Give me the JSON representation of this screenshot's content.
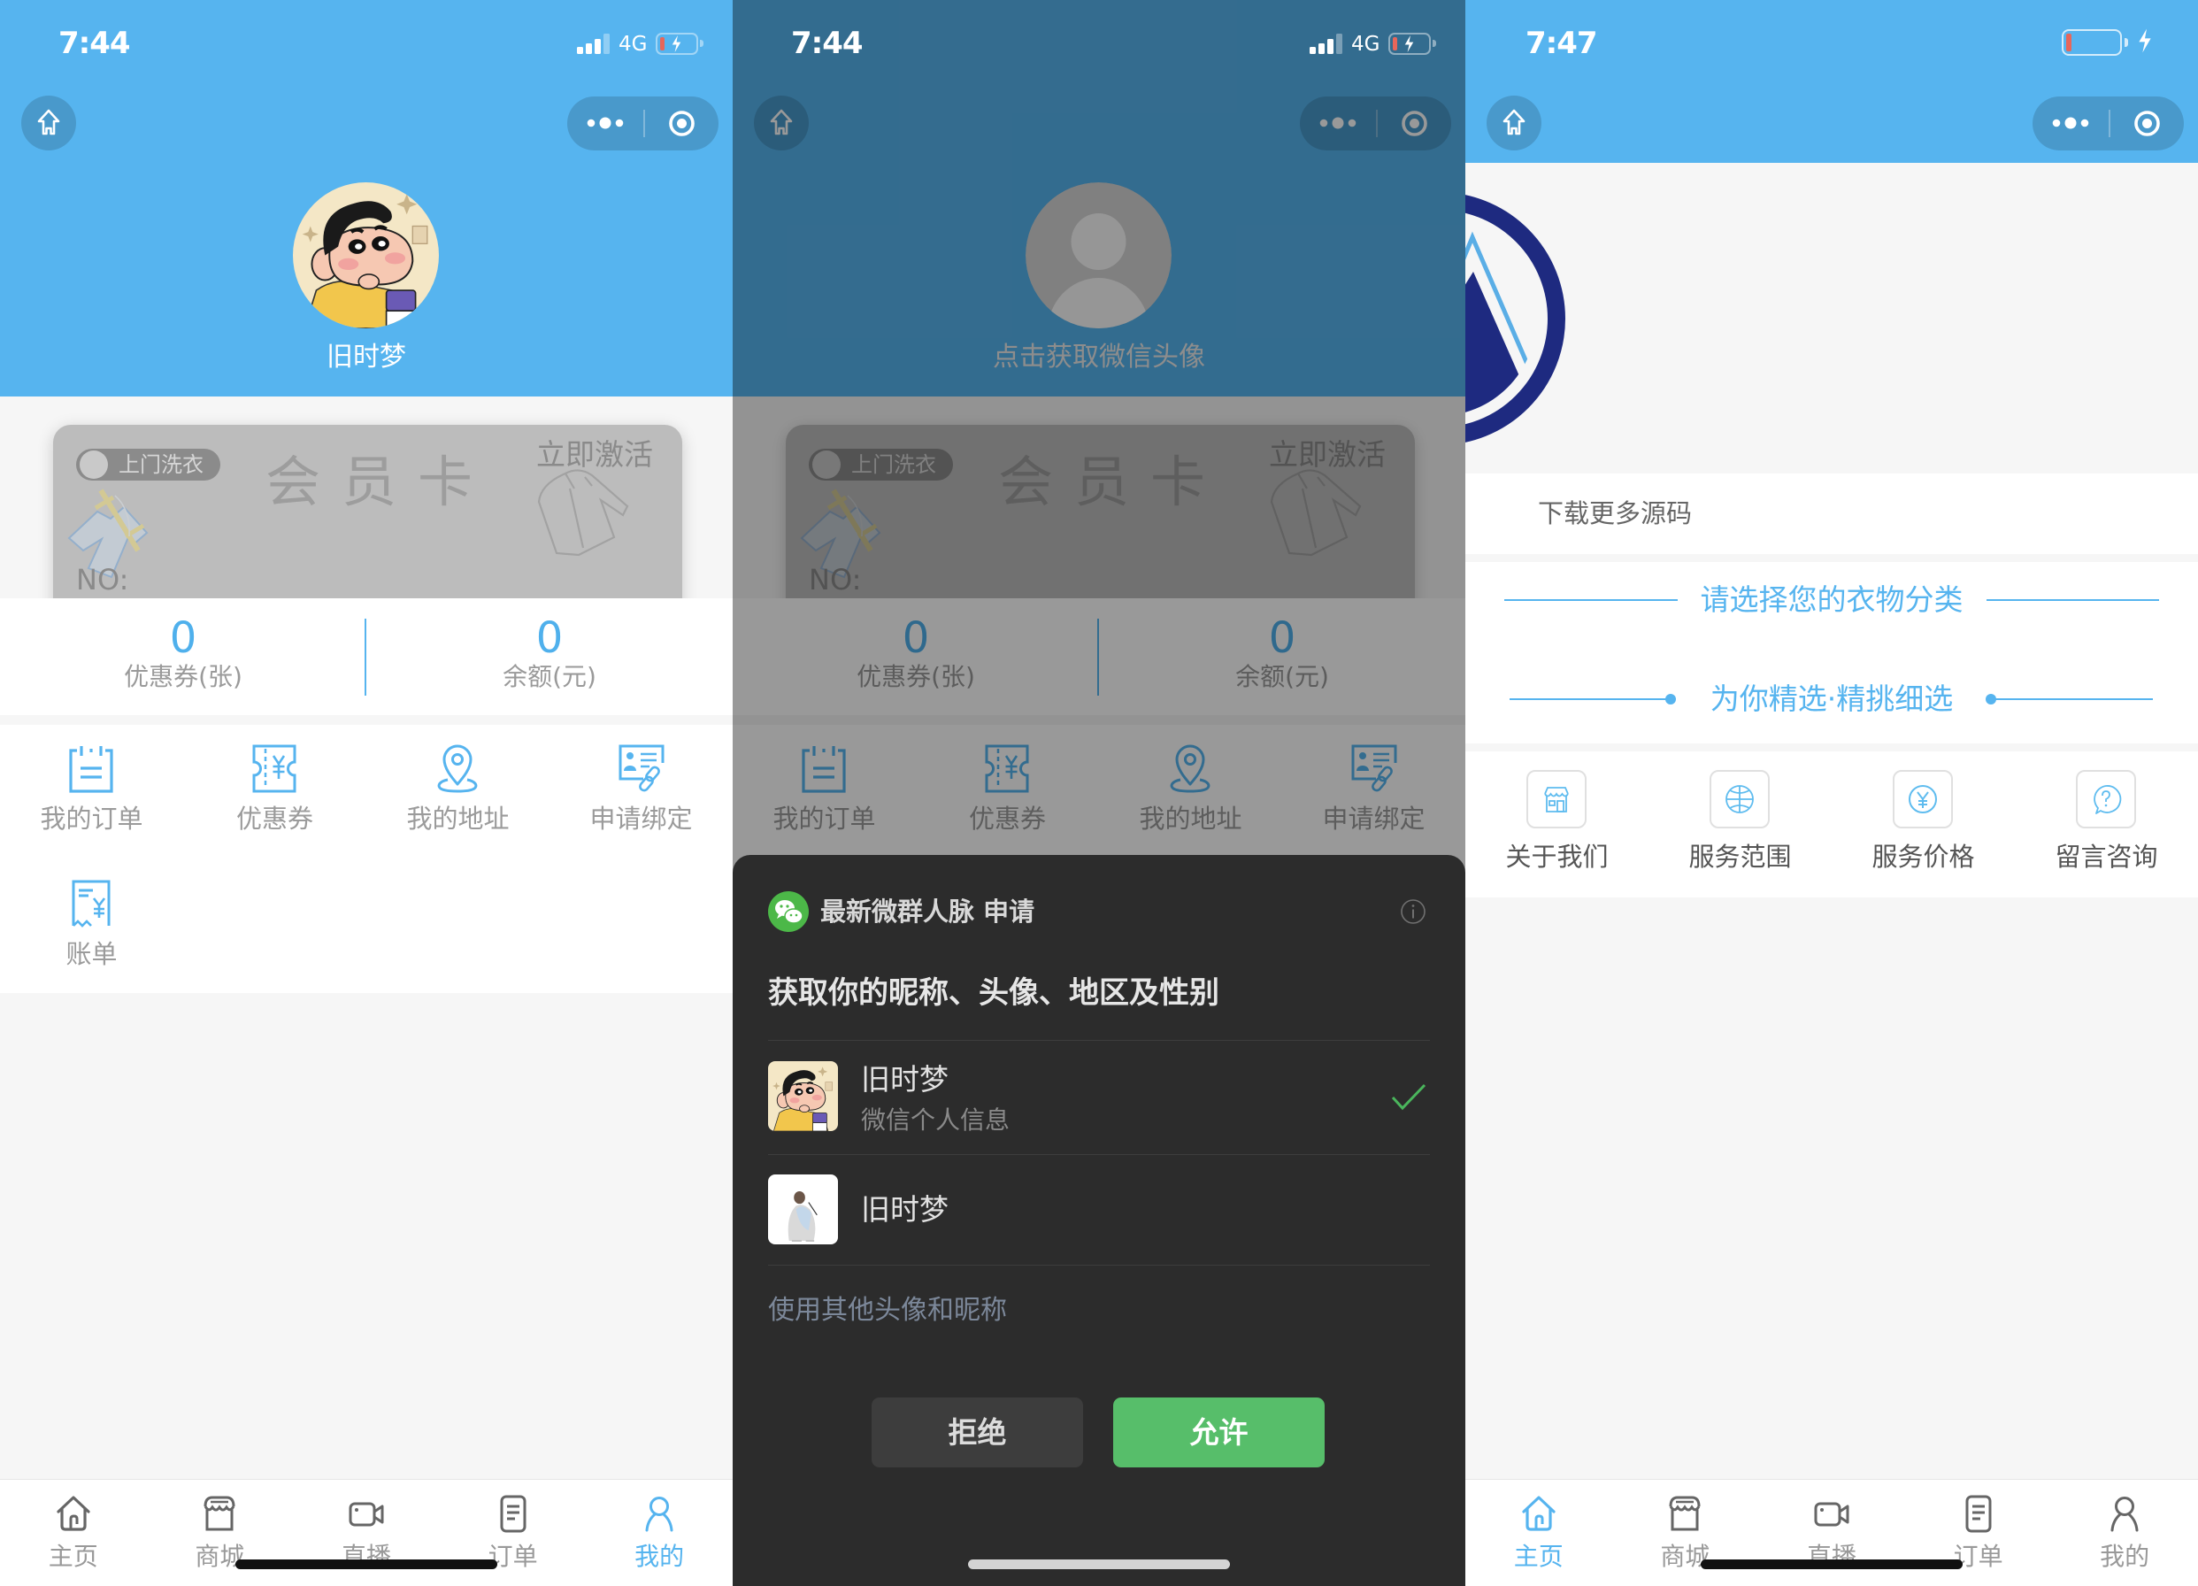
{
  "theme": {
    "accent": "#56b4ef",
    "allow_button": "#57be6a",
    "sheet_background": "#2c2c2c",
    "low_battery": "#e8665a"
  },
  "tabbar": [
    {
      "label": "主页",
      "icon": "home-icon"
    },
    {
      "label": "商城",
      "icon": "store-icon"
    },
    {
      "label": "直播",
      "icon": "video-camera-icon"
    },
    {
      "label": "订单",
      "icon": "document-icon"
    },
    {
      "label": "我的",
      "icon": "user-icon"
    }
  ],
  "screens": {
    "profile": {
      "status_bar": {
        "time": "7:44",
        "network": "4G",
        "battery_level": 0.12,
        "charging": true
      },
      "username": "旧时梦",
      "member_card": {
        "badge": "上门洗衣",
        "title": "会员卡",
        "activate": "立即激活",
        "number_label": "NO:"
      },
      "stats": [
        {
          "value": "0",
          "label": "优惠券(张)"
        },
        {
          "value": "0",
          "label": "余额(元)"
        }
      ],
      "menu": [
        {
          "label": "我的订单",
          "icon": "clipboard-icon"
        },
        {
          "label": "优惠券",
          "icon": "coupon-icon"
        },
        {
          "label": "我的地址",
          "icon": "location-pin-icon"
        },
        {
          "label": "申请绑定",
          "icon": "id-card-link-icon"
        },
        {
          "label": "账单",
          "icon": "receipt-icon"
        }
      ],
      "active_tab": "我的"
    },
    "auth": {
      "status_bar": {
        "time": "7:44",
        "network": "4G",
        "battery_level": 0.12,
        "charging": true
      },
      "avatar_prompt": "点击获取微信头像",
      "member_card": {
        "badge": "上门洗衣",
        "title": "会员卡",
        "activate": "立即激活",
        "number_label": "NO:"
      },
      "stats": [
        {
          "value": "0",
          "label": "优惠券(张)"
        },
        {
          "value": "0",
          "label": "余额(元)"
        }
      ],
      "menu": [
        {
          "label": "我的订单",
          "icon": "clipboard-icon"
        },
        {
          "label": "优惠券",
          "icon": "coupon-icon"
        },
        {
          "label": "我的地址",
          "icon": "location-pin-icon"
        },
        {
          "label": "申请绑定",
          "icon": "id-card-link-icon"
        }
      ],
      "auth_sheet": {
        "app_icon": "wechat-icon",
        "app_name": "最新微群人脉",
        "request_label": "申请",
        "heading": "获取你的昵称、头像、地区及性别",
        "profiles": [
          {
            "name": "旧时梦",
            "subtitle": "微信个人信息",
            "selected": true
          },
          {
            "name": "旧时梦",
            "selected": false
          }
        ],
        "other_option": "使用其他头像和昵称",
        "reject_label": "拒绝",
        "allow_label": "允许"
      }
    },
    "home": {
      "status_bar": {
        "time": "7:47",
        "battery_level": 0.1,
        "charging": true
      },
      "notice": "下载更多源码",
      "category_title": "请选择您的衣物分类",
      "category_subtitle": "为你精选·精挑细选",
      "services": [
        {
          "label": "关于我们",
          "icon": "store-icon"
        },
        {
          "label": "服务范围",
          "icon": "globe-icon"
        },
        {
          "label": "服务价格",
          "icon": "yen-circle-icon"
        },
        {
          "label": "留言咨询",
          "icon": "question-bubble-icon"
        }
      ],
      "active_tab": "主页"
    }
  }
}
